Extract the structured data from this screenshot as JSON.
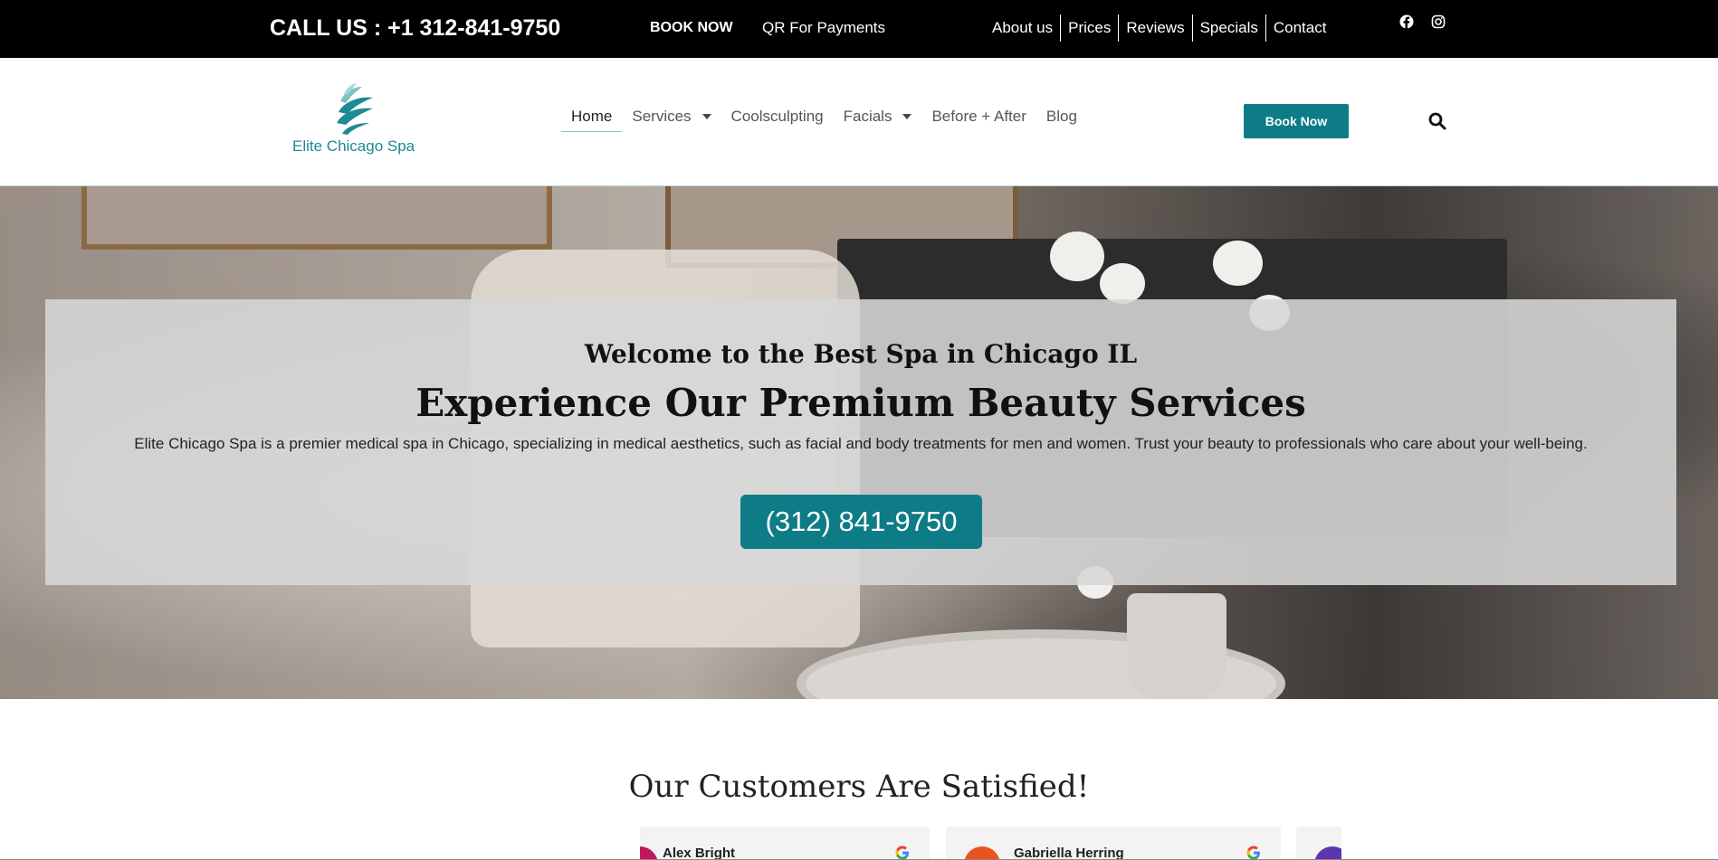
{
  "topbar": {
    "call_text": "CALL US : +1 312-841-9750",
    "book_now": "BOOK NOW",
    "qr_payments": "QR For Payments",
    "links": [
      "About us",
      "Prices",
      "Reviews",
      "Specials",
      "Contact"
    ],
    "social_icons": [
      "facebook-icon",
      "instagram-icon"
    ]
  },
  "header": {
    "logo_text": "Elite Chicago Spa",
    "nav": {
      "home": "Home",
      "services": "Services",
      "coolsculpting": "Coolsculpting",
      "facials": "Facials",
      "before_after": "Before + After",
      "blog": "Blog"
    },
    "book_button": "Book Now",
    "search_icon": "search-icon"
  },
  "hero": {
    "welcome": "Welcome to the Best Spa in Chicago IL",
    "headline": "Experience Our Premium Beauty Services",
    "description": "Elite Chicago Spa is a premier medical spa in Chicago, specializing in medical aesthetics, such as facial and body treatments for men and women. Trust your beauty to professionals who care about your well-being.",
    "phone_button": "(312) 841-9750"
  },
  "reviews": {
    "title": "Our Customers Are Satisfied!",
    "cards": [
      {
        "name": "Alex Bright"
      },
      {
        "name": "Gabriella Herring"
      }
    ]
  },
  "colors": {
    "accent": "#0e7c87",
    "topbar_bg": "#000000",
    "logo": "#1d8a95"
  }
}
